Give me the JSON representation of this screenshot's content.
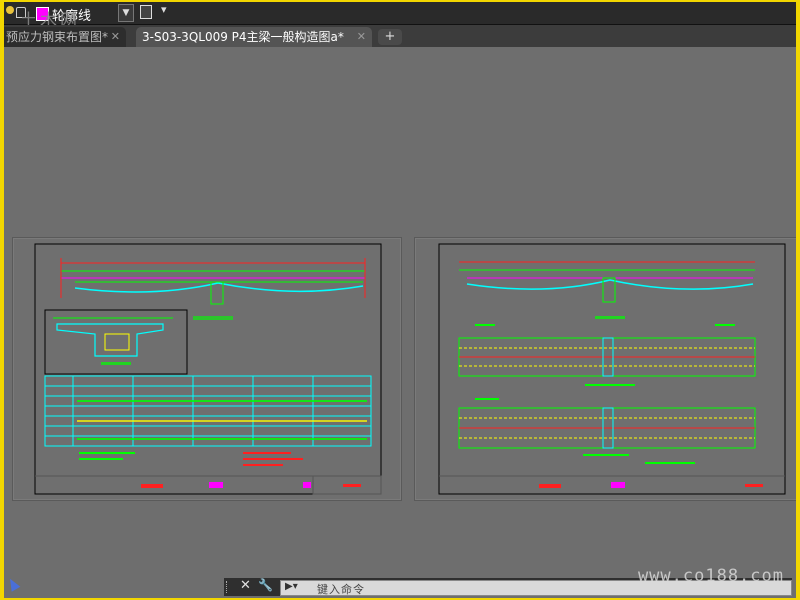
{
  "toolbar": {
    "layer_name": "轮廓线",
    "layer_color": "#ff00ff",
    "icons": [
      "lightbulb-icon",
      "lock-icon",
      "chevron-down-icon",
      "save-icon",
      "more-icon"
    ]
  },
  "watermarks": {
    "top": "土木网",
    "bottom": "www.co188.com"
  },
  "tabs": [
    {
      "label": "预应力钢束布置图*",
      "active": false,
      "close": "✕"
    },
    {
      "label": "3-S03-3QL009 P4主梁一般构造图a*",
      "active": true,
      "close": "✕"
    }
  ],
  "tab_add_label": "+",
  "command_line": {
    "close_icon": "✕",
    "wrench_icon": "🔧",
    "prompt_icon": "▶▾",
    "placeholder": "键入命令"
  },
  "colors": {
    "frame_border": "#f2d600",
    "canvas": "#6e6e6e",
    "drawing_green": "#00ff00",
    "drawing_red": "#ff2020",
    "drawing_magenta": "#ff00ff",
    "drawing_yellow": "#ffff00",
    "drawing_cyan": "#00ffff"
  }
}
